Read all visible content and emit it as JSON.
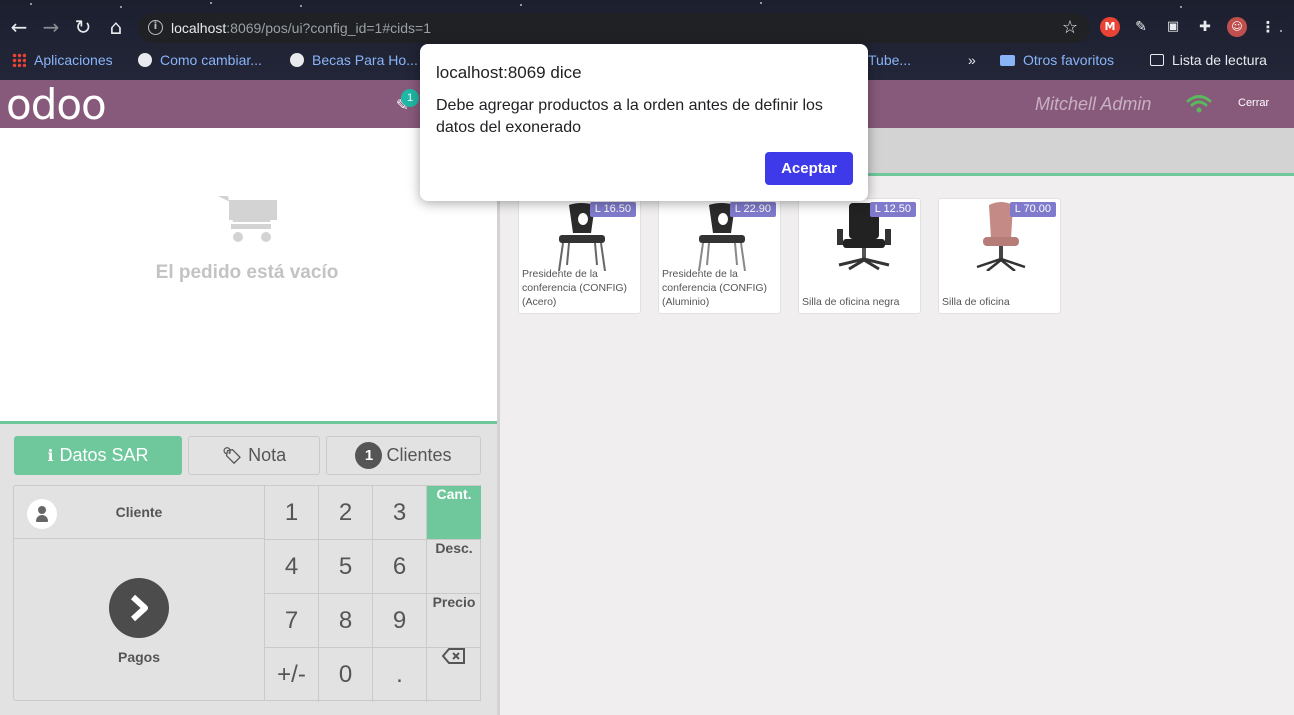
{
  "browser": {
    "url_host": "localhost",
    "url_rest": ":8069/pos/ui?config_id=1#cids=1",
    "bookmarks": [
      "Aplicaciones",
      "Como cambiar...",
      "Becas Para Ho...",
      "Tube...",
      "»",
      "Otros favoritos",
      "Lista de lectura"
    ]
  },
  "header": {
    "logo": "odoo",
    "order_count": "1",
    "user": "Mitchell Admin",
    "close_label": "Cerrar",
    "wifi_color": "#5cb85c"
  },
  "order": {
    "empty_text": "El pedido está vacío"
  },
  "controls": {
    "datos_sar": "Datos SAR",
    "nota": "Nota",
    "clientes_count": "1",
    "clientes": "Clientes"
  },
  "actionpad": {
    "client": "Cliente",
    "payment": "Pagos"
  },
  "numpad": {
    "keys": [
      "1",
      "2",
      "3",
      "4",
      "5",
      "6",
      "7",
      "8",
      "9",
      "+/-",
      "0",
      "."
    ],
    "modes": [
      "Cant.",
      "Desc.",
      "Precio"
    ],
    "active_mode": "Cant."
  },
  "products": [
    {
      "price": "L 16.50",
      "name": "Presidente de la conferencia (CONFIG) (Acero)"
    },
    {
      "price": "L 22.90",
      "name": "Presidente de la conferencia (CONFIG) (Aluminio)"
    },
    {
      "price": "L 12.50",
      "name": "Silla de oficina negra"
    },
    {
      "price": "L 70.00",
      "name": "Silla de oficina"
    }
  ],
  "dialog": {
    "title": "localhost:8069 dice",
    "message": "Debe agregar productos a la orden antes de definir los datos del exonerado",
    "ok": "Aceptar"
  },
  "colors": {
    "brand": "#875a7b",
    "accent_green": "#6ec89b",
    "price_tag": "#7f7acb",
    "dialog_button": "#3f3ae9"
  }
}
